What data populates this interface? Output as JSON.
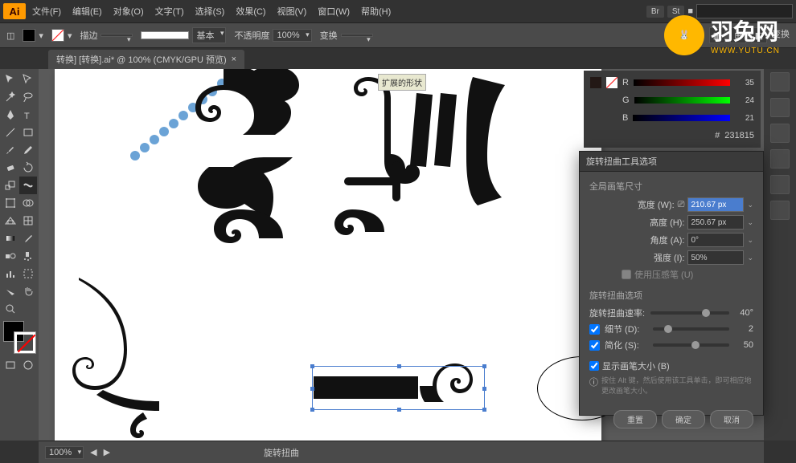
{
  "app": {
    "logo": "Ai"
  },
  "menu": {
    "items": [
      "文件(F)",
      "编辑(E)",
      "对象(O)",
      "文字(T)",
      "选择(S)",
      "效果(C)",
      "视图(V)",
      "窗口(W)",
      "帮助(H)"
    ],
    "badges": [
      "Br",
      "St"
    ]
  },
  "toolbar": {
    "stroke_label": "描边",
    "style_label": "基本",
    "opacity_label": "不透明度",
    "opacity_value": "100%",
    "preset_label": "变换"
  },
  "doctab": {
    "title": "转换] [转换].ai* @ 100% (CMYK/GPU 预览)",
    "close": "×"
  },
  "canvas": {
    "tooltip": "扩展的形状"
  },
  "colors": {
    "rows": [
      {
        "label": "R",
        "val": "35",
        "color": "#b00"
      },
      {
        "label": "G",
        "val": "24",
        "color": "#0b0"
      },
      {
        "label": "B",
        "val": "21",
        "color": "#00b"
      }
    ],
    "hex_prefix": "#",
    "hex": "231815"
  },
  "dialog": {
    "title": "旋转扭曲工具选项",
    "sec_brush": "全局画笔尺寸",
    "width_label": "宽度 (W):",
    "width_value": "210.67 px",
    "height_label": "高度 (H):",
    "height_value": "250.67 px",
    "angle_label": "角度 (A):",
    "angle_value": "0°",
    "intensity_label": "强度 (I):",
    "intensity_value": "50%",
    "pressure_label": "使用压感笔 (U)",
    "sec_twirl": "旋转扭曲选项",
    "rate_label": "旋转扭曲速率:",
    "rate_value": "40°",
    "detail_label": "细节 (D):",
    "detail_value": "2",
    "simplify_label": "简化 (S):",
    "simplify_value": "50",
    "showbrush_label": "显示画笔大小 (B)",
    "info_icon": "ⓘ",
    "info_text": "按住 Alt 键，然后使用该工具单击，即可相应地更改画笔大小。",
    "btn_reset": "重置",
    "btn_ok": "确定",
    "btn_cancel": "取消"
  },
  "status": {
    "zoom": "100%",
    "tool": "旋转扭曲"
  },
  "watermark": {
    "bunny": "🐰",
    "name": "羽兔网",
    "url": "WWW.YUTU.CN"
  },
  "icons": {
    "selection": "sel",
    "direct": "dir",
    "wand": "wand",
    "lasso": "lasso",
    "pen": "pen",
    "type": "type",
    "line": "line",
    "rect": "rect",
    "brush": "brush",
    "pencil": "pencil",
    "eraser": "eraser",
    "rotate": "rotate",
    "scale": "scale",
    "warp": "warp",
    "free": "free",
    "gradient": "grad",
    "eyedrop": "eye",
    "blend": "blend",
    "symbol": "sym",
    "graph": "graph",
    "artboard": "art",
    "slice": "slice",
    "hand": "hand",
    "zoom": "zoom"
  }
}
